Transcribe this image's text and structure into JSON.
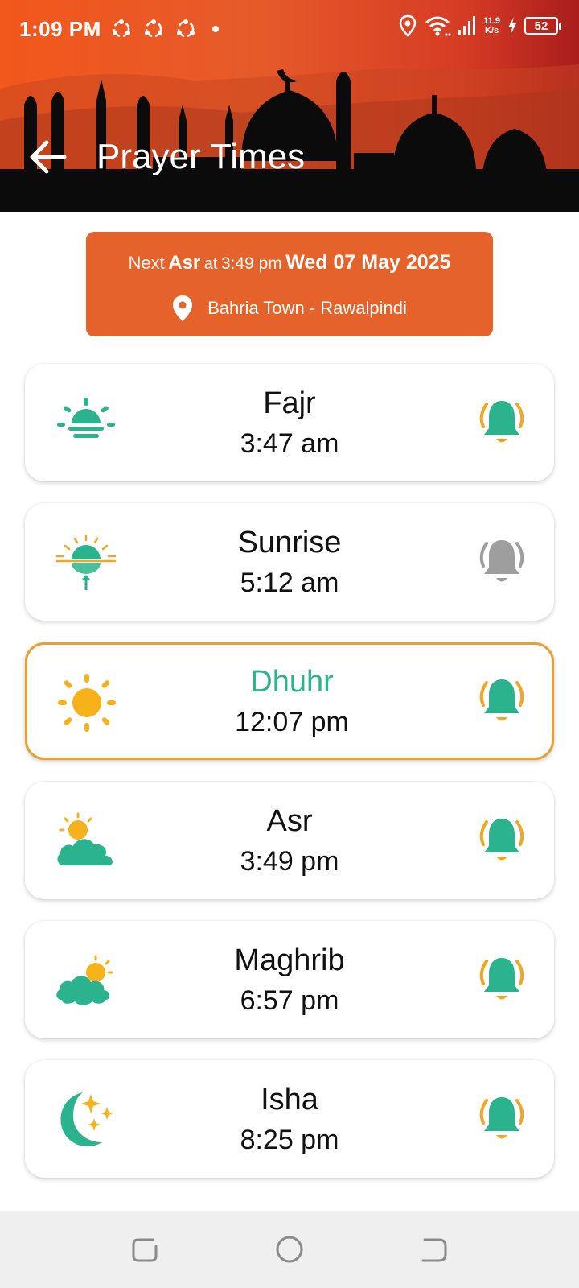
{
  "status_bar": {
    "time": "1:09 PM",
    "speed_value": "11.9",
    "speed_unit": "K/s",
    "battery": "52"
  },
  "app_bar": {
    "title": "Prayer Times",
    "back_icon": "arrow-left-icon"
  },
  "next_prayer": {
    "label": "Next",
    "prayer": "Asr",
    "at": "at",
    "time": "3:49 pm",
    "date": "Wed 07 May 2025",
    "location": "Bahria Town - Rawalpindi",
    "location_icon": "map-pin-icon"
  },
  "prayers": [
    {
      "name": "Fajr",
      "time": "3:47 am",
      "icon": "sunrise-horizon-icon",
      "alarm": "on"
    },
    {
      "name": "Sunrise",
      "time": "5:12 am",
      "icon": "sunrise-arrow-icon",
      "alarm": "off"
    },
    {
      "name": "Dhuhr",
      "time": "12:07 pm",
      "icon": "sun-icon",
      "alarm": "on"
    },
    {
      "name": "Asr",
      "time": "3:49 pm",
      "icon": "sun-cloud-icon",
      "alarm": "on"
    },
    {
      "name": "Maghrib",
      "time": "6:57 pm",
      "icon": "cloud-sun-icon",
      "alarm": "on"
    },
    {
      "name": "Isha",
      "time": "8:25 pm",
      "icon": "moon-stars-icon",
      "alarm": "on"
    }
  ],
  "colors": {
    "header_orange": "#e65a2a",
    "banner_orange": "#e6622b",
    "teal": "#2bb38d",
    "amber": "#f2a623",
    "bell_off": "#9e9e9e",
    "active_border": "#e8a033"
  }
}
